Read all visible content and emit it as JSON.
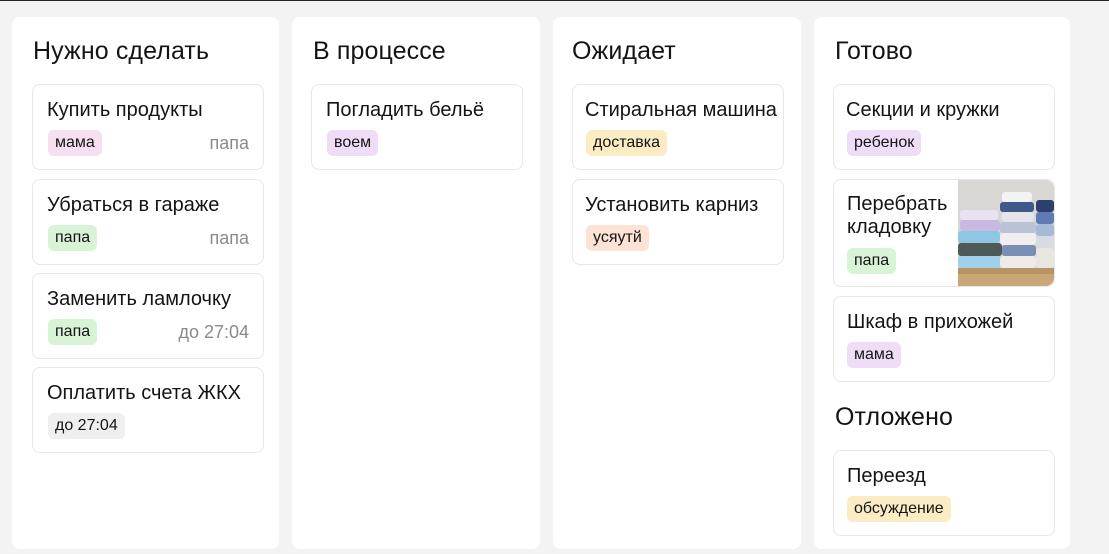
{
  "columns": {
    "todo": {
      "title": "Нужно сделать",
      "cards": [
        {
          "title": "Купить продукты",
          "tag": "мама",
          "meta": "папа"
        },
        {
          "title": "Убраться в гараже",
          "tag": "папа",
          "meta": "папа"
        },
        {
          "title": "Заменить ламлочку",
          "tag": "папа",
          "meta": "до 27:04"
        },
        {
          "title": "Оплатить счета ЖКХ",
          "tag": "до 27:04"
        }
      ]
    },
    "in_progress": {
      "title": "В процессе",
      "cards": [
        {
          "title": "Погладить бельё",
          "tag": "воем"
        }
      ]
    },
    "waiting": {
      "title": "Ожидает",
      "cards": [
        {
          "title": "Стиральная машина",
          "tag": "доставка"
        },
        {
          "title": "Установить карниз",
          "tag": "усяутй"
        }
      ]
    },
    "done": {
      "title": "Готово",
      "cards": [
        {
          "title": "Секции и кружки",
          "tag": "ребенок"
        },
        {
          "title_line1": "Перебрать",
          "title_line2": "кладовку",
          "tag": "папа",
          "image": "folded-clothes-photo"
        },
        {
          "title": "Шкаф в прихожей",
          "tag": "мама"
        }
      ]
    },
    "postponed": {
      "title": "Отложено",
      "cards": [
        {
          "title": "Переезд",
          "tag": "обсуждение"
        }
      ]
    }
  },
  "colors": {
    "background": "#f3f3f3",
    "column": "#ffffff",
    "tag_pink": "#f6dff0",
    "tag_green": "#d8f3d6",
    "tag_orange": "#fce3d3",
    "tag_yellow": "#fcecc4",
    "tag_lavender": "#efdcf6",
    "tag_gray": "#efefef"
  }
}
